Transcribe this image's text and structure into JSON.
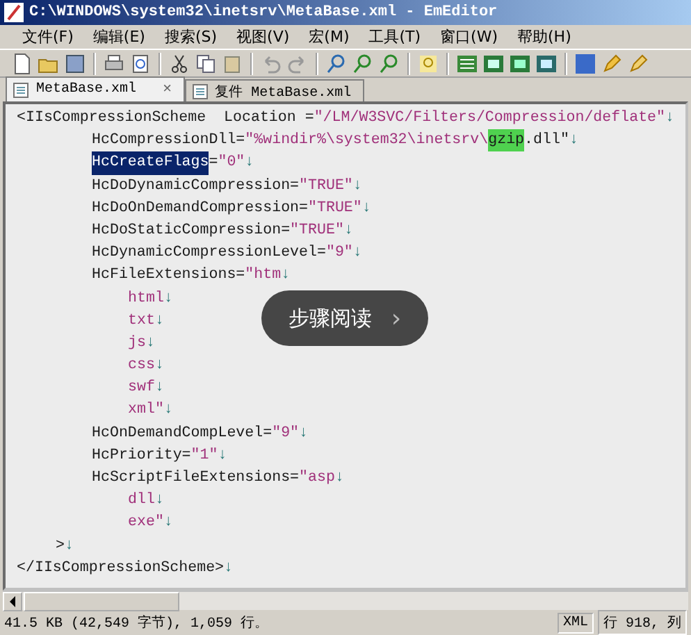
{
  "window": {
    "title": "C:\\WINDOWS\\system32\\inetsrv\\MetaBase.xml - EmEditor"
  },
  "menu": [
    "文件(F)",
    "编辑(E)",
    "搜索(S)",
    "视图(V)",
    "宏(M)",
    "工具(T)",
    "窗口(W)",
    "帮助(H)"
  ],
  "tabs": [
    {
      "label": "MetaBase.xml",
      "selected": true,
      "close": "×"
    },
    {
      "label": "复件 MetaBase.xml",
      "selected": false
    }
  ],
  "lines": [
    {
      "kind": "top",
      "segments": [
        {
          "kind": "plain",
          "text": "<IIsCompressionScheme  Location ="
        },
        {
          "kind": "string",
          "text": "\"/LM/W3SVC/Filters/Compression/deflate\""
        },
        {
          "kind": "eol",
          "text": "↓"
        }
      ]
    },
    {
      "kind": "attr",
      "segments": [
        {
          "kind": "plain",
          "text": "HcCompressionDll="
        },
        {
          "kind": "string",
          "text": "\"%windir%\\system32\\inetsrv\\"
        },
        {
          "kind": "found",
          "text": "gzip"
        },
        {
          "kind": "plain",
          "text": ".dll\""
        },
        {
          "kind": "eol",
          "text": "↓"
        }
      ]
    },
    {
      "kind": "attr",
      "segments": [
        {
          "kind": "selected",
          "text": "HcCreateFlags"
        },
        {
          "kind": "plain",
          "text": "="
        },
        {
          "kind": "string",
          "text": "\"0\""
        },
        {
          "kind": "eol",
          "text": "↓"
        }
      ]
    },
    {
      "kind": "attr",
      "segments": [
        {
          "kind": "plain",
          "text": "HcDoDynamicCompression="
        },
        {
          "kind": "string",
          "text": "\"TRUE\""
        },
        {
          "kind": "eol",
          "text": "↓"
        }
      ]
    },
    {
      "kind": "attr",
      "segments": [
        {
          "kind": "plain",
          "text": "HcDoOnDemandCompression="
        },
        {
          "kind": "string",
          "text": "\"TRUE\""
        },
        {
          "kind": "eol",
          "text": "↓"
        }
      ]
    },
    {
      "kind": "attr",
      "segments": [
        {
          "kind": "plain",
          "text": "HcDoStaticCompression="
        },
        {
          "kind": "string",
          "text": "\"TRUE\""
        },
        {
          "kind": "eol",
          "text": "↓"
        }
      ]
    },
    {
      "kind": "attr",
      "segments": [
        {
          "kind": "plain",
          "text": "HcDynamicCompressionLevel="
        },
        {
          "kind": "string",
          "text": "\"9\""
        },
        {
          "kind": "eol",
          "text": "↓"
        }
      ]
    },
    {
      "kind": "attr",
      "segments": [
        {
          "kind": "plain",
          "text": "HcFileExtensions="
        },
        {
          "kind": "string",
          "text": "\"htm"
        },
        {
          "kind": "eol",
          "text": "↓"
        }
      ]
    },
    {
      "kind": "item",
      "segments": [
        {
          "kind": "string",
          "text": "html"
        },
        {
          "kind": "eol",
          "text": "↓"
        }
      ]
    },
    {
      "kind": "item",
      "segments": [
        {
          "kind": "string",
          "text": "txt"
        },
        {
          "kind": "eol",
          "text": "↓"
        }
      ]
    },
    {
      "kind": "item",
      "segments": [
        {
          "kind": "string",
          "text": "js"
        },
        {
          "kind": "eol",
          "text": "↓"
        }
      ]
    },
    {
      "kind": "item",
      "segments": [
        {
          "kind": "string",
          "text": "css"
        },
        {
          "kind": "eol",
          "text": "↓"
        }
      ]
    },
    {
      "kind": "item",
      "segments": [
        {
          "kind": "string",
          "text": "swf"
        },
        {
          "kind": "eol",
          "text": "↓"
        }
      ]
    },
    {
      "kind": "item",
      "segments": [
        {
          "kind": "string",
          "text": "xml\""
        },
        {
          "kind": "eol",
          "text": "↓"
        }
      ]
    },
    {
      "kind": "attr",
      "segments": [
        {
          "kind": "plain",
          "text": "HcOnDemandCompLevel="
        },
        {
          "kind": "string",
          "text": "\"9\""
        },
        {
          "kind": "eol",
          "text": "↓"
        }
      ]
    },
    {
      "kind": "attr",
      "segments": [
        {
          "kind": "plain",
          "text": "HcPriority="
        },
        {
          "kind": "string",
          "text": "\"1\""
        },
        {
          "kind": "eol",
          "text": "↓"
        }
      ]
    },
    {
      "kind": "attr",
      "segments": [
        {
          "kind": "plain",
          "text": "HcScriptFileExtensions="
        },
        {
          "kind": "string",
          "text": "\"asp"
        },
        {
          "kind": "eol",
          "text": "↓"
        }
      ]
    },
    {
      "kind": "item",
      "segments": [
        {
          "kind": "string",
          "text": "dll"
        },
        {
          "kind": "eol",
          "text": "↓"
        }
      ]
    },
    {
      "kind": "item",
      "segments": [
        {
          "kind": "string",
          "text": "exe\""
        },
        {
          "kind": "eol",
          "text": "↓"
        }
      ]
    },
    {
      "kind": "end",
      "segments": [
        {
          "kind": "plain",
          "text": ">"
        },
        {
          "kind": "eol",
          "text": "↓"
        }
      ]
    },
    {
      "kind": "top",
      "segments": [
        {
          "kind": "plain",
          "text": "</IIsCompressionScheme>"
        },
        {
          "kind": "eol",
          "text": "↓"
        }
      ]
    }
  ],
  "overlay_button": {
    "label": "步骤阅读",
    "arrow": "›"
  },
  "status_bar": {
    "info": "41.5 KB (42,549 字节), 1,059 行。",
    "mode": "XML",
    "position": "行 918, 列"
  }
}
